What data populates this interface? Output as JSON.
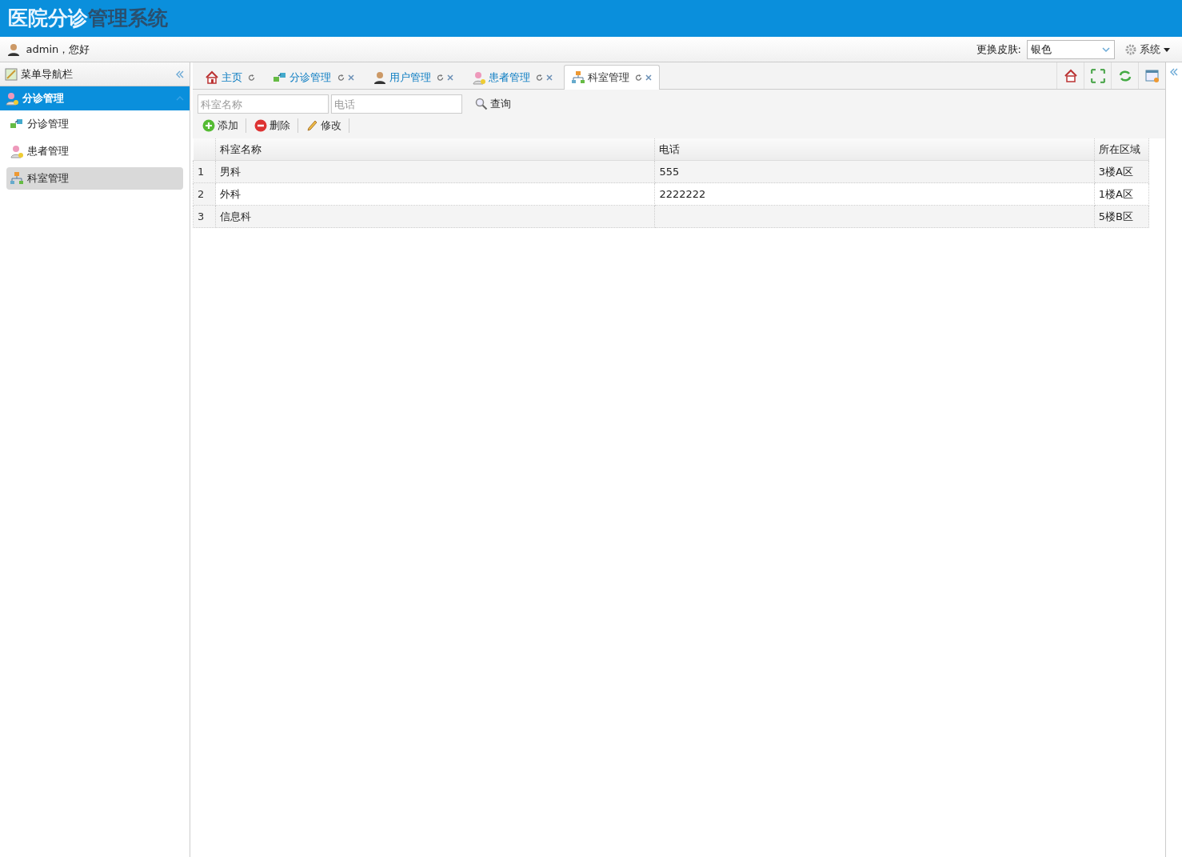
{
  "header": {
    "title": [
      "医院分诊",
      "管理系统"
    ]
  },
  "user_bar": {
    "greeting": "admin，您好",
    "skin_label": "更换皮肤:",
    "skin_value": "银色",
    "system_menu": "系统"
  },
  "sidebar": {
    "title": "菜单导航栏",
    "panel": {
      "title": "分诊管理",
      "expanded": true
    },
    "items": [
      {
        "label": "分诊管理",
        "kind": "triage",
        "selected": false
      },
      {
        "label": "患者管理",
        "kind": "patient",
        "selected": false
      },
      {
        "label": "科室管理",
        "kind": "dept",
        "selected": true
      }
    ]
  },
  "tabs": [
    {
      "label": "主页",
      "kind": "home",
      "closable": false,
      "selected": false
    },
    {
      "label": "分诊管理",
      "kind": "triage",
      "closable": true,
      "selected": false
    },
    {
      "label": "用户管理",
      "kind": "user",
      "closable": true,
      "selected": false
    },
    {
      "label": "患者管理",
      "kind": "patient",
      "closable": true,
      "selected": false
    },
    {
      "label": "科室管理",
      "kind": "dept",
      "closable": true,
      "selected": true
    }
  ],
  "search": {
    "fields": [
      {
        "placeholder": "科室名称"
      },
      {
        "placeholder": "电话"
      }
    ],
    "button": "查询"
  },
  "toolbar": [
    {
      "label": "添加",
      "kind": "add"
    },
    {
      "label": "删除",
      "kind": "delete"
    },
    {
      "label": "修改",
      "kind": "edit"
    }
  ],
  "table": {
    "columns": [
      "科室名称",
      "电话",
      "所在区域"
    ],
    "rows": [
      {
        "number": "1",
        "cells": [
          "男科",
          "555",
          "3楼A区"
        ]
      },
      {
        "number": "2",
        "cells": [
          "外科",
          "2222222",
          "1楼A区"
        ]
      },
      {
        "number": "3",
        "cells": [
          "信息科",
          "",
          "5楼B区"
        ]
      }
    ]
  }
}
